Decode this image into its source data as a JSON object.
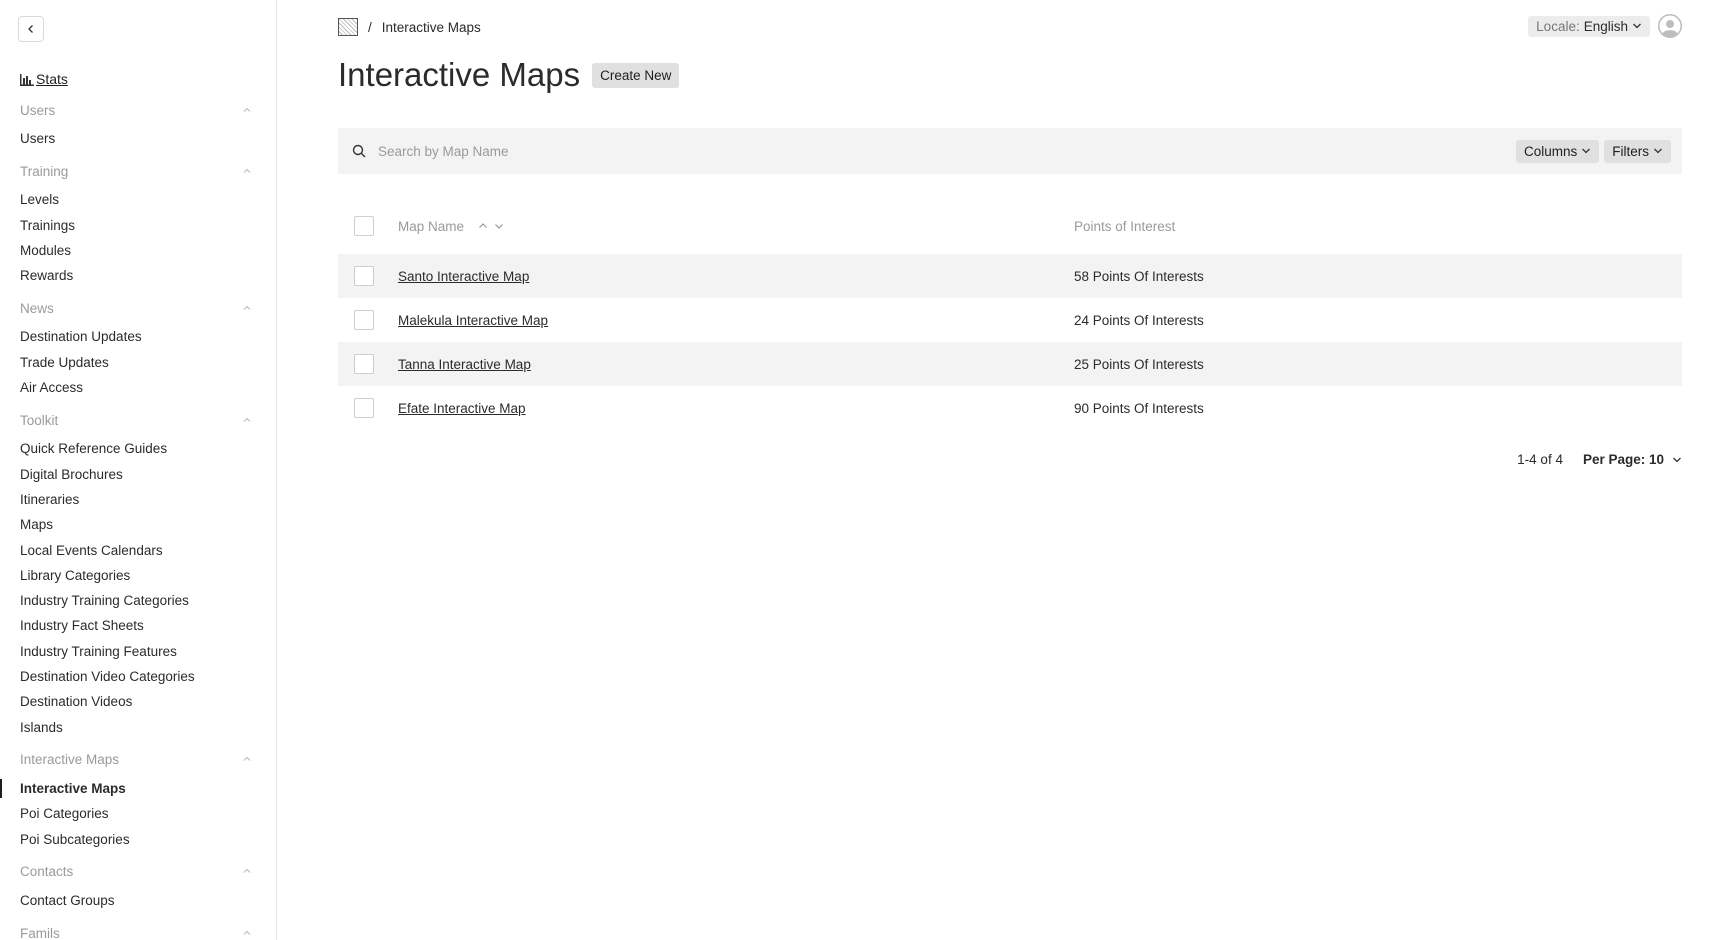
{
  "sidebar": {
    "stats_label": "Stats",
    "groups": [
      {
        "title": "Users",
        "items": [
          {
            "label": "Users"
          }
        ]
      },
      {
        "title": "Training",
        "items": [
          {
            "label": "Levels"
          },
          {
            "label": "Trainings"
          },
          {
            "label": "Modules"
          },
          {
            "label": "Rewards"
          }
        ]
      },
      {
        "title": "News",
        "items": [
          {
            "label": "Destination Updates"
          },
          {
            "label": "Trade Updates"
          },
          {
            "label": "Air Access"
          }
        ]
      },
      {
        "title": "Toolkit",
        "items": [
          {
            "label": "Quick Reference Guides"
          },
          {
            "label": "Digital Brochures"
          },
          {
            "label": "Itineraries"
          },
          {
            "label": "Maps"
          },
          {
            "label": "Local Events Calendars"
          },
          {
            "label": "Library Categories"
          },
          {
            "label": "Industry Training Categories"
          },
          {
            "label": "Industry Fact Sheets"
          },
          {
            "label": "Industry Training Features"
          },
          {
            "label": "Destination Video Categories"
          },
          {
            "label": "Destination Videos"
          },
          {
            "label": "Islands"
          }
        ]
      },
      {
        "title": "Interactive Maps",
        "items": [
          {
            "label": "Interactive Maps",
            "active": true
          },
          {
            "label": "Poi Categories"
          },
          {
            "label": "Poi Subcategories"
          }
        ]
      },
      {
        "title": "Contacts",
        "items": [
          {
            "label": "Contact Groups"
          }
        ]
      },
      {
        "title": "Famils",
        "items": []
      }
    ]
  },
  "header": {
    "breadcrumb_separator": "/",
    "breadcrumb_current": "Interactive Maps",
    "locale_label": "Locale:",
    "locale_value": "English"
  },
  "page": {
    "title": "Interactive Maps",
    "create_button": "Create New"
  },
  "toolbar": {
    "search_placeholder": "Search by Map Name",
    "columns_label": "Columns",
    "filters_label": "Filters"
  },
  "table": {
    "headers": {
      "name": "Map Name",
      "poi": "Points of Interest"
    },
    "rows": [
      {
        "name": "Santo Interactive Map",
        "poi": "58 Points Of Interests"
      },
      {
        "name": "Malekula Interactive Map",
        "poi": "24 Points Of Interests"
      },
      {
        "name": "Tanna Interactive Map",
        "poi": "25 Points Of Interests"
      },
      {
        "name": "Efate Interactive Map",
        "poi": "90 Points Of Interests"
      }
    ]
  },
  "pagination": {
    "range": "1-4 of 4",
    "per_page": "Per Page: 10"
  }
}
